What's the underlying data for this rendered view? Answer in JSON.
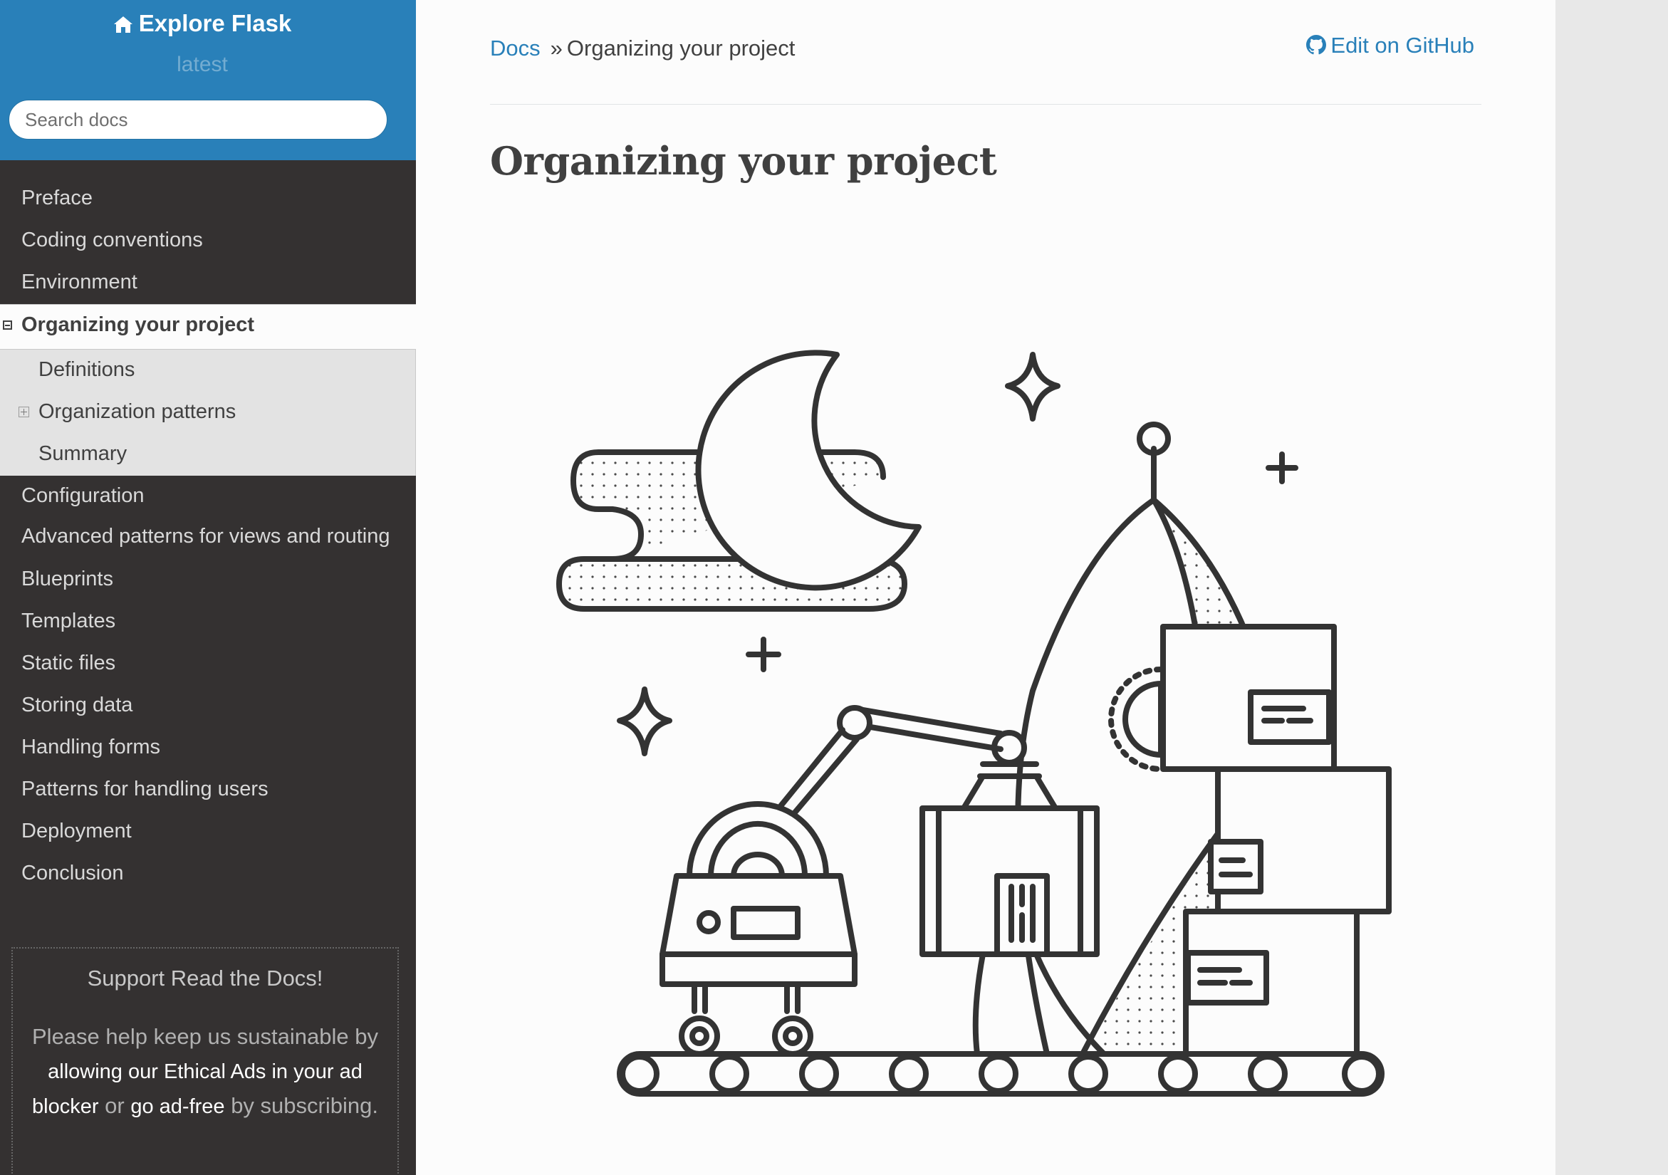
{
  "sidebar": {
    "project_title": "Explore Flask",
    "version": "latest",
    "search_placeholder": "Search docs",
    "nav_before": [
      "Preface",
      "Coding conventions",
      "Environment"
    ],
    "current": "Organizing your project",
    "subitems": [
      "Definitions",
      "Organization patterns",
      "Summary"
    ],
    "nav_after": [
      "Configuration",
      "Advanced patterns for views and routing",
      "Blueprints",
      "Templates",
      "Static files",
      "Storing data",
      "Handling forms",
      "Patterns for handling users",
      "Deployment",
      "Conclusion"
    ],
    "ad": {
      "title": "Support Read the Docs!",
      "p1": "Please help keep us sustainable by",
      "link1": "allowing our Ethical Ads in your ad blocker",
      "p2": "or",
      "link2": "go ad-free",
      "p3": "by subscribing."
    }
  },
  "breadcrumb": {
    "docs": "Docs",
    "separator": "»",
    "current": "Organizing your project"
  },
  "edit_link": "Edit on GitHub",
  "page_title": "Organizing your project",
  "icons": {
    "home": "home-icon",
    "github": "github-icon",
    "collapse": "collapse-toggle-icon",
    "expand": "expand-toggle-icon"
  },
  "colors": {
    "brand": "#2980b9",
    "sidebar_bg": "#343131",
    "link": "#2980b9",
    "text": "#404040"
  }
}
